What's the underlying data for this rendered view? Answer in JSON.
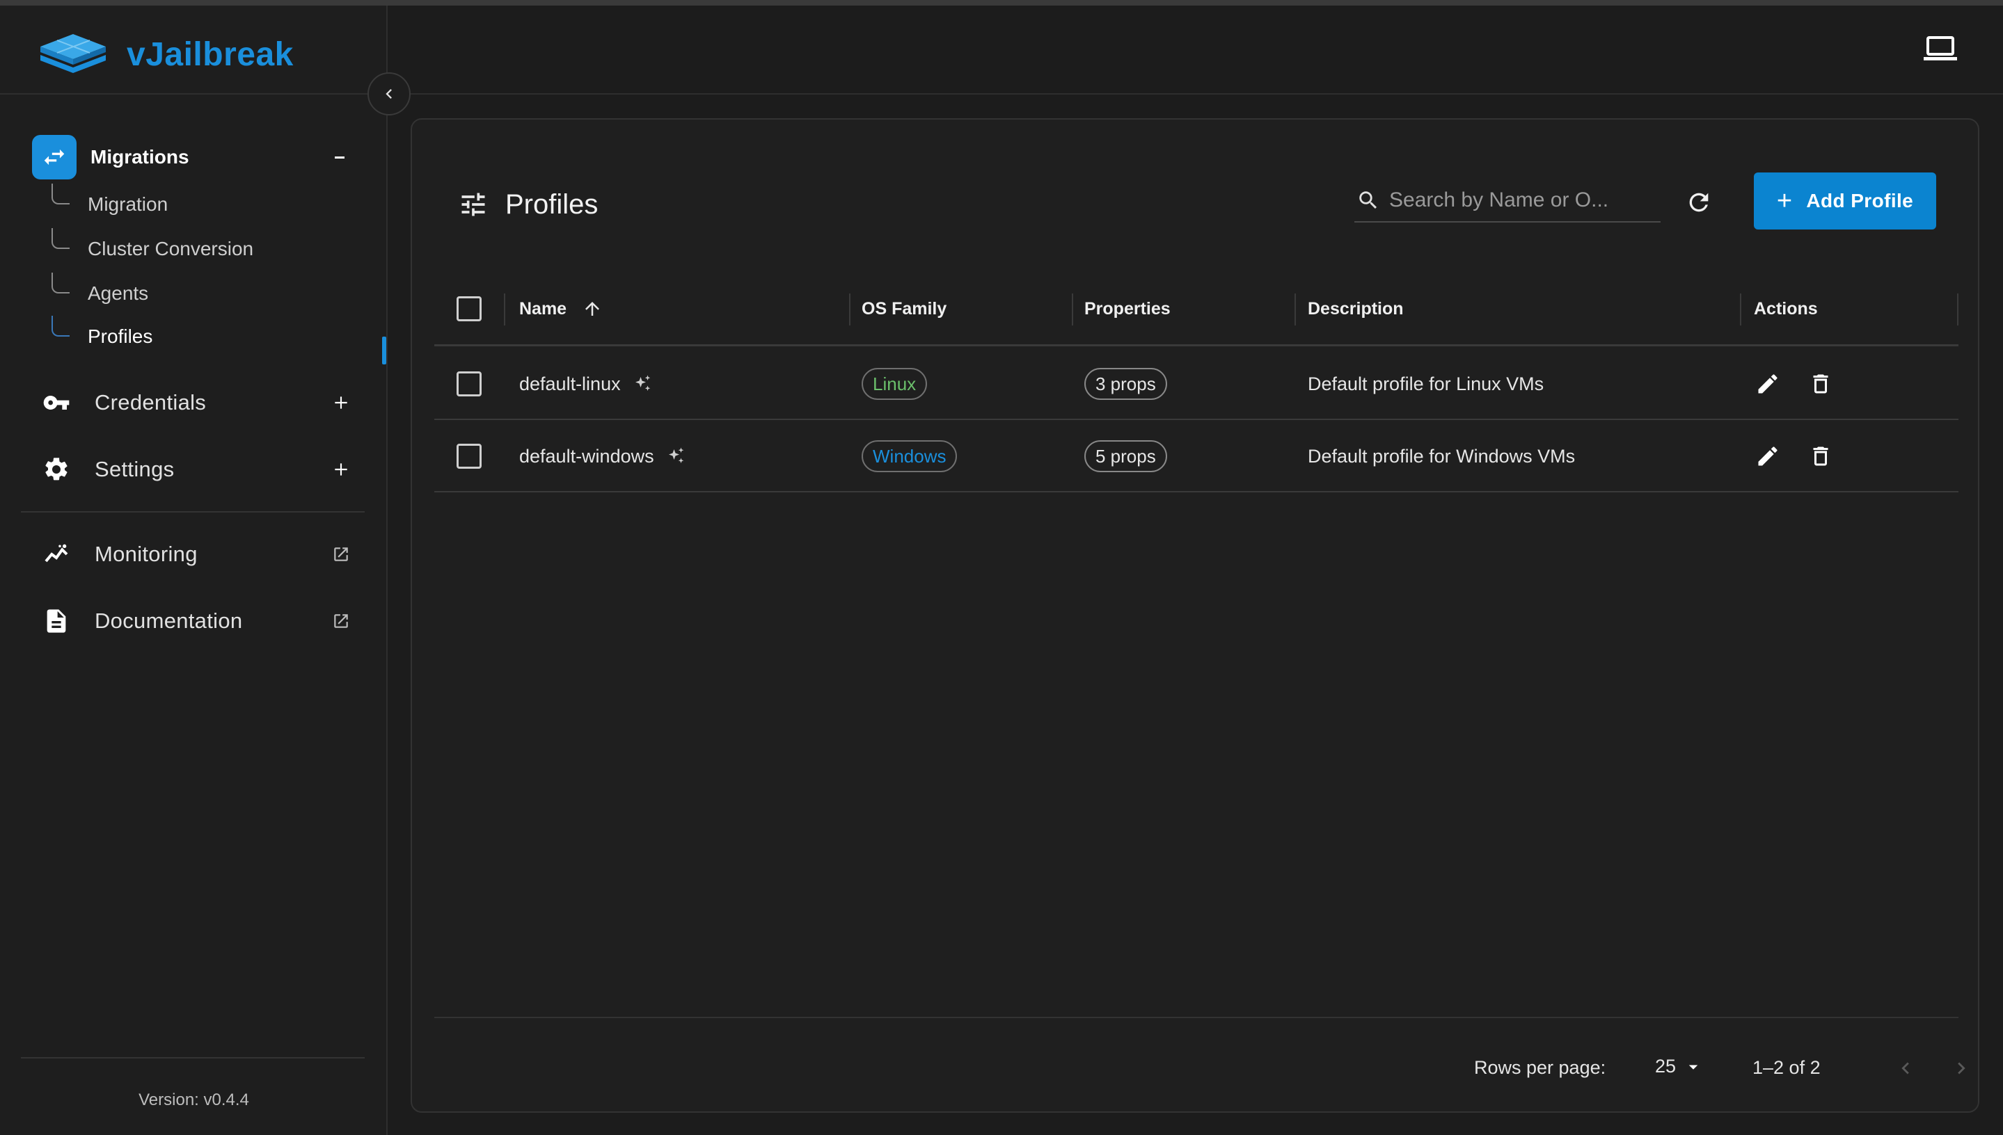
{
  "app": {
    "name": "vJailbreak",
    "version": "Version: v0.4.4"
  },
  "sidebar": {
    "group": {
      "label": "Migrations",
      "toggle": "−"
    },
    "subitems": [
      {
        "label": "Migration"
      },
      {
        "label": "Cluster Conversion"
      },
      {
        "label": "Agents"
      },
      {
        "label": "Profiles",
        "active": true
      }
    ],
    "items": [
      {
        "label": "Credentials",
        "icon": "key-icon",
        "tail": "plus-icon"
      },
      {
        "label": "Settings",
        "icon": "gear-icon",
        "tail": "plus-icon"
      },
      {
        "label": "Monitoring",
        "icon": "monitoring-icon",
        "tail": "external-link-icon"
      },
      {
        "label": "Documentation",
        "icon": "document-icon",
        "tail": "external-link-icon"
      }
    ]
  },
  "page": {
    "title": "Profiles",
    "search_placeholder": "Search by Name or O...",
    "add_button": "Add Profile"
  },
  "table": {
    "columns": [
      "Name",
      "OS Family",
      "Properties",
      "Description",
      "Actions"
    ],
    "rows": [
      {
        "name": "default-linux",
        "os": "Linux",
        "props": "3 props",
        "description": "Default profile for Linux VMs"
      },
      {
        "name": "default-windows",
        "os": "Windows",
        "props": "5 props",
        "description": "Default profile for Windows VMs"
      }
    ]
  },
  "pagination": {
    "rows_per_page_label": "Rows per page:",
    "rows_per_page": "25",
    "range": "1–2 of 2"
  },
  "colors": {
    "accent": "#1a8fdc",
    "background": "#1c1c1c",
    "linux": "#6bbf6b"
  }
}
